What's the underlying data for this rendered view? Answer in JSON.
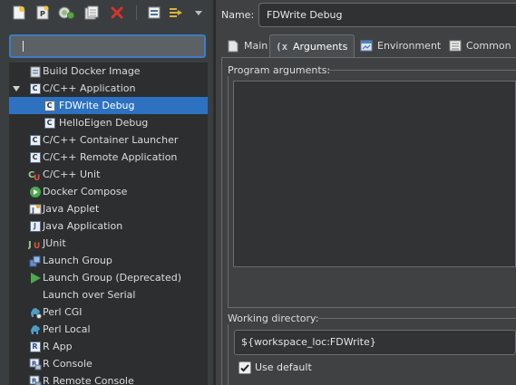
{
  "colors": {
    "accent": "#2e71c1",
    "focus_border": "#3e7cc2",
    "panel_bg": "#3f4143",
    "tree_bg": "#2c2e30"
  },
  "toolbar": {
    "icons": [
      "new-config-icon",
      "duplicate-config-icon",
      "new-prototype-icon",
      "export-icon",
      "delete-icon",
      "collapse-all-icon",
      "filter-icon",
      "view-menu-icon"
    ]
  },
  "filter": {
    "value": "",
    "placeholder": ""
  },
  "tree": {
    "items": [
      {
        "label": "Build Docker Image",
        "icon": "docker-build-icon",
        "indent": 1
      },
      {
        "label": "C/C++ Application",
        "icon": "c-app-icon",
        "indent": 1,
        "expanded": true
      },
      {
        "label": "FDWrite Debug",
        "icon": "c-config-icon",
        "indent": 2,
        "selected": true
      },
      {
        "label": "HelloEigen Debug",
        "icon": "c-config-icon",
        "indent": 2
      },
      {
        "label": "C/C++ Container Launcher",
        "icon": "c-app-icon",
        "indent": 1
      },
      {
        "label": "C/C++ Remote Application",
        "icon": "c-app-icon",
        "indent": 1
      },
      {
        "label": "C/C++ Unit",
        "icon": "c-unit-icon",
        "indent": 1
      },
      {
        "label": "Docker Compose",
        "icon": "docker-compose-icon",
        "indent": 1
      },
      {
        "label": "Java Applet",
        "icon": "java-applet-icon",
        "indent": 1
      },
      {
        "label": "Java Application",
        "icon": "java-app-icon",
        "indent": 1
      },
      {
        "label": "JUnit",
        "icon": "junit-icon",
        "indent": 1
      },
      {
        "label": "Launch Group",
        "icon": "launch-group-icon",
        "indent": 1
      },
      {
        "label": "Launch Group (Deprecated)",
        "icon": "launch-group-deprecated-icon",
        "indent": 1
      },
      {
        "label": "Launch over Serial",
        "icon": "",
        "indent": 1
      },
      {
        "label": "Perl CGI",
        "icon": "perl-cgi-icon",
        "indent": 1
      },
      {
        "label": "Perl Local",
        "icon": "perl-local-icon",
        "indent": 1
      },
      {
        "label": "R App",
        "icon": "r-app-icon",
        "indent": 1
      },
      {
        "label": "R Console",
        "icon": "r-console-icon",
        "indent": 1
      },
      {
        "label": "R Remote Console",
        "icon": "r-remote-console-icon",
        "indent": 1
      }
    ]
  },
  "config": {
    "name_label": "Name:",
    "name_value": "FDWrite Debug",
    "tabs": [
      {
        "label": "Main",
        "icon": "main-tab-icon"
      },
      {
        "label": "Arguments",
        "icon": "arguments-tab-icon",
        "active": true
      },
      {
        "label": "Environment",
        "icon": "environment-tab-icon"
      },
      {
        "label": "Common",
        "icon": "common-tab-icon"
      }
    ],
    "program_args_label": "Program arguments:",
    "program_args_value": "",
    "working_dir_label": "Working directory:",
    "working_dir_value": "${workspace_loc:FDWrite}",
    "use_default_label": "Use default",
    "use_default_checked": true
  }
}
